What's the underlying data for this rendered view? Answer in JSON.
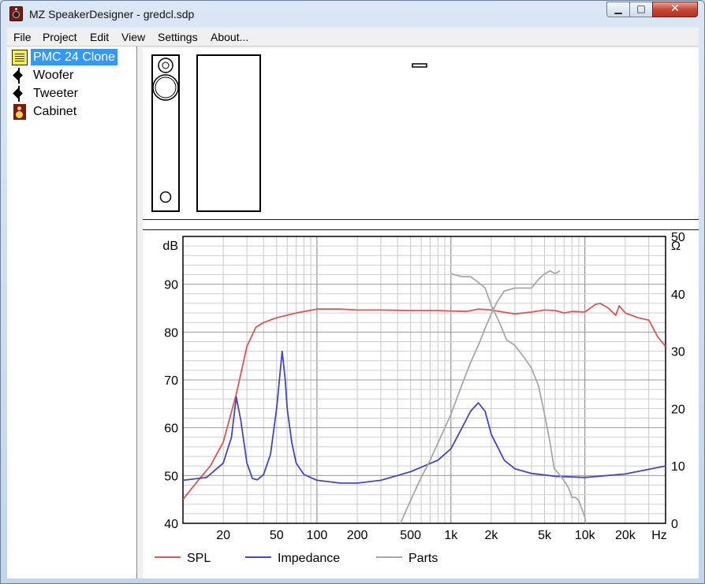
{
  "window": {
    "title": "MZ SpeakerDesigner - gredcl.sdp",
    "min_label": "▁",
    "max_label": "□",
    "close_label": "✕"
  },
  "menu": [
    "File",
    "Project",
    "Edit",
    "View",
    "Settings",
    "About..."
  ],
  "tree": {
    "project": "PMC 24 Clone",
    "items": [
      "Woofer",
      "Tweeter",
      "Cabinet"
    ]
  },
  "chart_data": {
    "type": "line",
    "xscale": "log",
    "xlim": [
      10,
      40000
    ],
    "x_ticks": [
      20,
      50,
      100,
      200,
      500,
      1000,
      2000,
      5000,
      10000,
      20000
    ],
    "x_tick_labels": [
      "20",
      "50",
      "100",
      "200",
      "500",
      "1k",
      "2k",
      "5k",
      "10k",
      "20k"
    ],
    "x_unit": "Hz",
    "ylabel_left": "dB",
    "ylabel_right": "Ω",
    "ylim_left": [
      40,
      100
    ],
    "ylim_right": [
      0,
      50
    ],
    "y_ticks_left": [
      40,
      50,
      60,
      70,
      80,
      90
    ],
    "y_ticks_right": [
      0,
      10,
      20,
      30,
      40,
      50
    ],
    "grid": true,
    "legend_position": "bottom",
    "series": [
      {
        "name": "SPL",
        "axis": "left",
        "color": "#e05555",
        "x": [
          10,
          13,
          16,
          20,
          25,
          30,
          35,
          40,
          50,
          70,
          100,
          150,
          200,
          300,
          500,
          800,
          1000,
          1300,
          1600,
          2000,
          3000,
          4000,
          5000,
          6000,
          7000,
          8000,
          10000,
          12000,
          13000,
          15000,
          17000,
          18000,
          20000,
          25000,
          30000,
          35000,
          40000
        ],
        "y": [
          45,
          49,
          52,
          57,
          67,
          77,
          81,
          82,
          83,
          84,
          84.8,
          84.8,
          84.6,
          84.6,
          84.5,
          84.5,
          84.4,
          84.3,
          84.8,
          84.6,
          83.8,
          84.2,
          84.6,
          84.5,
          84,
          84.3,
          84.2,
          85.8,
          86,
          85,
          83.5,
          85.5,
          84,
          83,
          82.5,
          79,
          77
        ]
      },
      {
        "name": "Impedance",
        "axis": "right",
        "color": "#4444cc",
        "x": [
          10,
          15,
          20,
          23,
          25,
          27,
          30,
          33,
          36,
          40,
          45,
          50,
          55,
          58,
          60,
          65,
          70,
          80,
          100,
          150,
          200,
          300,
          500,
          800,
          1000,
          1200,
          1400,
          1600,
          1800,
          2000,
          2500,
          3000,
          4000,
          6000,
          10000,
          20000,
          40000
        ],
        "y": [
          7.5,
          8,
          10.5,
          15,
          22,
          18,
          10.5,
          7.8,
          7.6,
          8.5,
          12,
          20,
          30,
          25,
          20,
          14,
          10.5,
          8.5,
          7.5,
          7,
          7,
          7.5,
          9,
          11,
          13,
          16.5,
          19.5,
          21,
          19.5,
          15.5,
          11,
          9.5,
          8.7,
          8.2,
          8,
          8.6,
          10
        ]
      },
      {
        "name": "Parts",
        "axis": "right",
        "color": "#a8a8a8",
        "x": [
          420,
          500,
          600,
          700,
          800,
          1000,
          1200,
          1400,
          1600,
          1800,
          2000,
          2200,
          2500,
          3000,
          3500,
          4000,
          4500,
          5000,
          5500,
          6000,
          6500
        ],
        "y": [
          0,
          4,
          8,
          11,
          14,
          19,
          24,
          28,
          31,
          34,
          36.5,
          38.5,
          40.5,
          41,
          41,
          41,
          42.5,
          43.5,
          44,
          43.5,
          44
        ]
      },
      {
        "name": "Parts",
        "axis": "right",
        "color": "#a8a8a8",
        "legend": false,
        "x": [
          1000,
          1200,
          1400,
          1600,
          1800,
          2000,
          2300,
          2600,
          3000,
          3500,
          4000,
          4500,
          5000,
          5500,
          5900,
          6200,
          6700,
          7200,
          7600,
          8000,
          8500,
          9000,
          9500,
          10000,
          10400
        ],
        "y": [
          43.5,
          43,
          43,
          42,
          41,
          38,
          35,
          32,
          31,
          29,
          27,
          24,
          19,
          14,
          9.5,
          9,
          8,
          7,
          6,
          4.5,
          4.5,
          4,
          2.5,
          1,
          -2
        ]
      }
    ]
  }
}
